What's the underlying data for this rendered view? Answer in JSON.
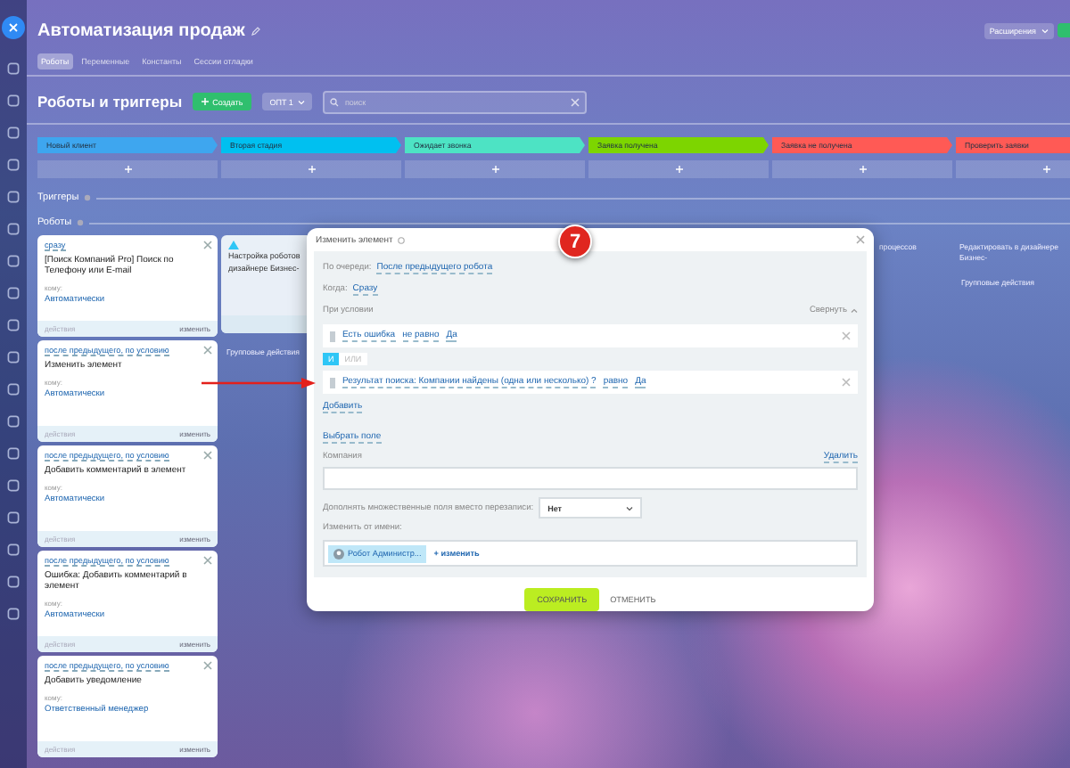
{
  "window": {
    "title": "Автоматизация продаж"
  },
  "tabs": [
    {
      "label": "Роботы",
      "selected": true
    },
    {
      "label": "Переменные",
      "selected": false
    },
    {
      "label": "Константы",
      "selected": false
    },
    {
      "label": "Сессии отладки",
      "selected": false
    }
  ],
  "extensions_button": {
    "label": "Расширения"
  },
  "toolbar": {
    "title": "Роботы и триггеры",
    "create_button": "Создать",
    "filter": "ОПТ 1",
    "search": {
      "placeholder": "поиск"
    }
  },
  "stages": [
    {
      "name": "Новый клиент",
      "color": "#3ea6ef"
    },
    {
      "name": "Вторая стадия",
      "color": "#00c0f0"
    },
    {
      "name": "Ожидает звонка",
      "color": "#4de3c4"
    },
    {
      "name": "Заявка получена",
      "color": "#7dd500"
    },
    {
      "name": "Заявка не получена",
      "color": "#ff5a55"
    },
    {
      "name": "Проверить заявки",
      "color": "#ff5a55"
    }
  ],
  "triggers": {
    "label": "Триггеры"
  },
  "robots": {
    "label": "Роботы",
    "columns": [
      {
        "cards": [
          {
            "condition": "сразу",
            "title": "[Поиск Компаний Pro] Поиск по Телефону или E-mail",
            "recipient_label": "кому:",
            "recipient": "Автоматически",
            "footer_left": "действия",
            "footer_right": "изменить"
          },
          {
            "condition": "после предыдущего, по условию",
            "title": "Изменить элемент",
            "recipient_label": "кому:",
            "recipient": "Автоматически",
            "footer_left": "действия",
            "footer_right": "изменить"
          },
          {
            "condition": "после предыдущего, по условию",
            "title": "Добавить комментарий в элемент",
            "recipient_label": "кому:",
            "recipient": "Автоматически",
            "footer_left": "действия",
            "footer_right": "изменить"
          },
          {
            "condition": "после предыдущего, по условию",
            "title": "Ошибка: Добавить комментарий в элемент",
            "recipient_label": "кому:",
            "recipient": "Автоматически",
            "footer_left": "действия",
            "footer_right": "изменить"
          },
          {
            "condition": "после предыдущего, по условию",
            "title": "Добавить уведомление",
            "recipient_label": "кому:",
            "recipient": "Ответственный менеджер",
            "footer_left": "действия",
            "footer_right": "изменить"
          }
        ]
      },
      {
        "notice": [
          "Настройка роботов",
          "дизайнере Бизнес-"
        ],
        "group_actions": "Групповые действия"
      },
      {},
      {},
      {
        "note": "процессов"
      },
      {
        "note": "Редактировать в дизайнере Бизнес-",
        "group_actions": "Групповые действия"
      }
    ]
  },
  "dialog": {
    "title": "Изменить элемент",
    "step_badge": "7",
    "order_label": "По очереди:",
    "order_value": "После предыдущего робота",
    "when_label": "Когда:",
    "when_value": "Сразу",
    "condition_label": "При условии",
    "collapse": "Свернуть",
    "conditions": [
      {
        "field": "Есть ошибка",
        "operator": "не равно",
        "value": "Да"
      },
      {
        "field": "Результат поиска: Компании найдены (одна или несколько) ?",
        "operator": "равно",
        "value": "Да"
      }
    ],
    "logic": [
      {
        "label": "И",
        "selected": true
      },
      {
        "label": "ИЛИ",
        "selected": false
      }
    ],
    "add_link": "Добавить",
    "choose_field": "Выбрать поле",
    "field_label": "Компания",
    "remove_link": "Удалить",
    "append_label": "Дополнять множественные поля вместо перезаписи:",
    "append_value": "Нет",
    "author_label": "Изменить от имени:",
    "author_chip": "Робот Администр...",
    "change_link": "+ изменить",
    "save": "СОХРАНИТЬ",
    "cancel": "ОТМЕНИТЬ"
  }
}
